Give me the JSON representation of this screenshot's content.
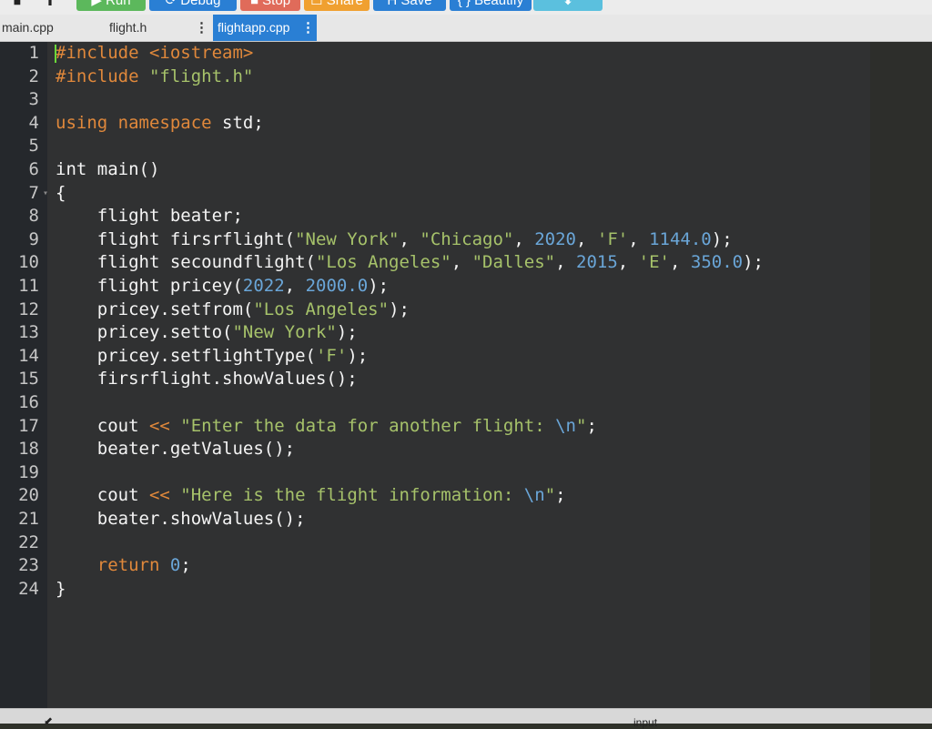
{
  "toolbar": {
    "buttons": [
      {
        "label": "▶ Run",
        "color": "#5cb85c"
      },
      {
        "label": "⟳ Debug",
        "color": "#2a7fd4"
      },
      {
        "label": "■ Stop",
        "color": "#e06b5a"
      },
      {
        "label": "☐ Share",
        "color": "#f0a030"
      },
      {
        "label": "H Save",
        "color": "#2a7fd4"
      },
      {
        "label": "{ } Beautify",
        "color": "#2a7fd4"
      },
      {
        "label": "⬇",
        "color": "#5bc0de"
      }
    ],
    "left_icons": [
      "stop-square-icon",
      "upload-icon"
    ]
  },
  "tabs": [
    {
      "label": "main.cpp",
      "active": false
    },
    {
      "label": "flight.h",
      "active": false
    },
    {
      "label": "flightapp.cpp",
      "active": true
    }
  ],
  "tab_menu_icon": "⋮",
  "editor": {
    "lines": [
      {
        "n": "1",
        "code": "<span class=\"pp\">#include</span> <span class=\"pp\">&lt;iostream&gt;</span>"
      },
      {
        "n": "2",
        "code": "<span class=\"pp\">#include</span> <span class=\"str\">\"flight.h\"</span>"
      },
      {
        "n": "3",
        "code": ""
      },
      {
        "n": "4",
        "code": "<span class=\"kw\">using</span> <span class=\"kw\">namespace</span> std;"
      },
      {
        "n": "5",
        "code": ""
      },
      {
        "n": "6",
        "code": "int main()"
      },
      {
        "n": "7",
        "code": "{",
        "fold": true
      },
      {
        "n": "8",
        "code": "    flight beater;"
      },
      {
        "n": "9",
        "code": "    flight firsrflight(<span class=\"str\">\"New York\"</span>, <span class=\"str\">\"Chicago\"</span>, <span class=\"num\">2020</span>, <span class=\"str\">'F'</span>, <span class=\"num\">1144.0</span>);"
      },
      {
        "n": "10",
        "code": "    flight secoundflight(<span class=\"str\">\"Los Angeles\"</span>, <span class=\"str\">\"Dalles\"</span>, <span class=\"num\">2015</span>, <span class=\"str\">'E'</span>, <span class=\"num\">350.0</span>);"
      },
      {
        "n": "11",
        "code": "    flight pricey(<span class=\"num\">2022</span>, <span class=\"num\">2000.0</span>);"
      },
      {
        "n": "12",
        "code": "    pricey.setfrom(<span class=\"str\">\"Los Angeles\"</span>);"
      },
      {
        "n": "13",
        "code": "    pricey.setto(<span class=\"str\">\"New York\"</span>);"
      },
      {
        "n": "14",
        "code": "    pricey.setflightType(<span class=\"str\">'F'</span>);"
      },
      {
        "n": "15",
        "code": "    firsrflight.showValues();"
      },
      {
        "n": "16",
        "code": ""
      },
      {
        "n": "17",
        "code": "    cout <span class=\"kw\">&lt;&lt;</span> <span class=\"str\">\"Enter the data for another flight: </span><span class=\"num\">\\n</span><span class=\"str\">\"</span>;"
      },
      {
        "n": "18",
        "code": "    beater.getValues();"
      },
      {
        "n": "19",
        "code": ""
      },
      {
        "n": "20",
        "code": "    cout <span class=\"kw\">&lt;&lt;</span> <span class=\"str\">\"Here is the flight information: </span><span class=\"num\">\\n</span><span class=\"str\">\"</span>;"
      },
      {
        "n": "21",
        "code": "    beater.showValues();"
      },
      {
        "n": "22",
        "code": ""
      },
      {
        "n": "23",
        "code": "    <span class=\"kw\">return</span> <span class=\"num\">0</span>;"
      },
      {
        "n": "24",
        "code": "}"
      }
    ]
  },
  "bottom": {
    "label": "input",
    "arrow": "⬋"
  }
}
